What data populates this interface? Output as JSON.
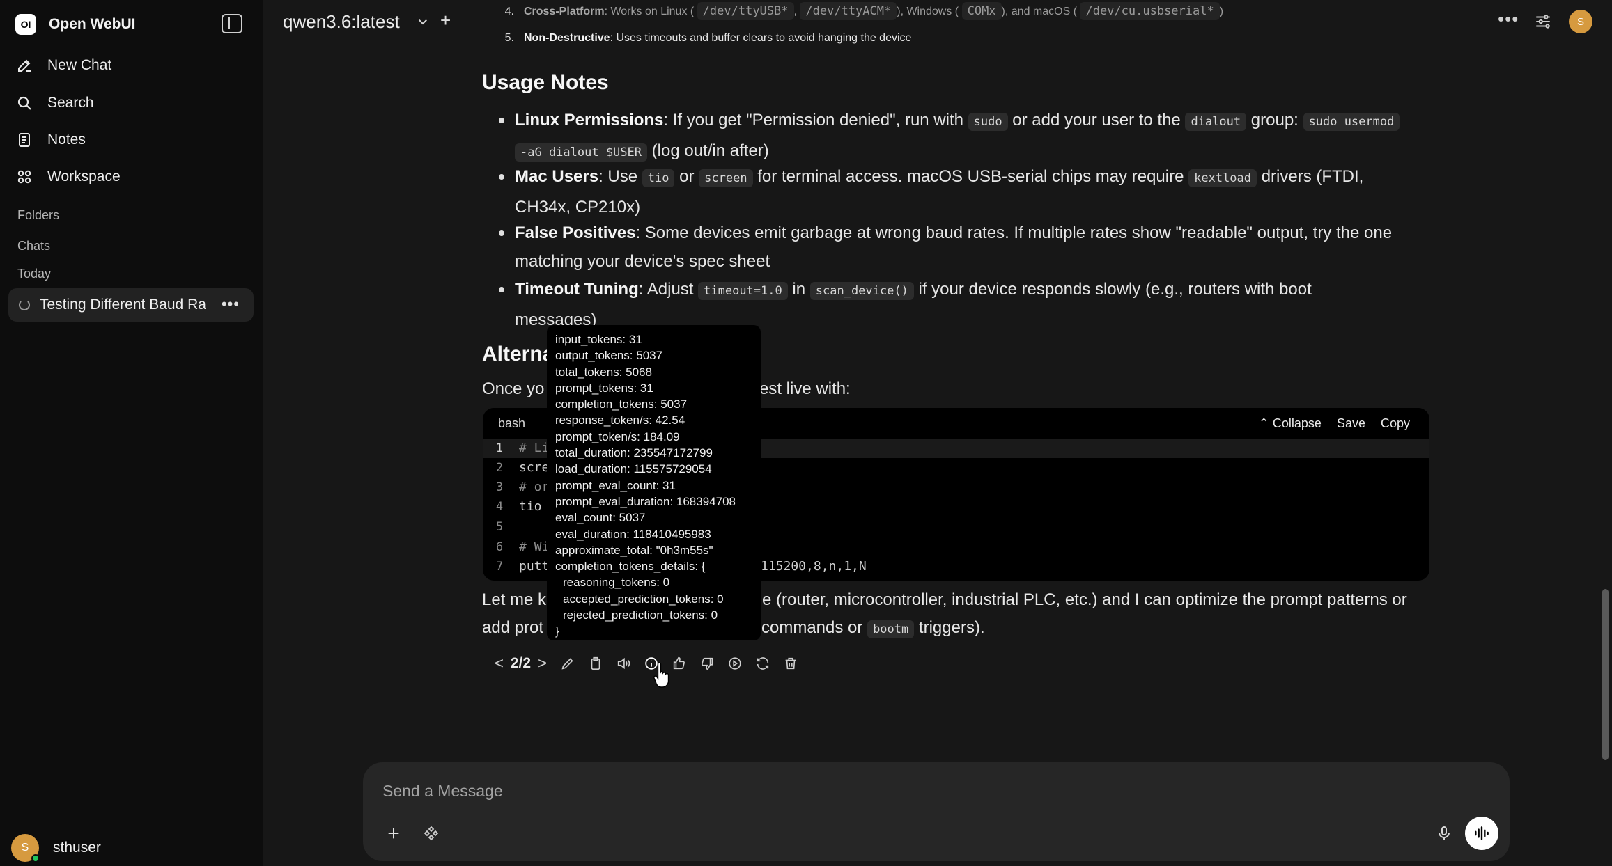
{
  "sidebar": {
    "brand_logo": "OI",
    "brand_name": "Open WebUI",
    "nav": [
      {
        "label": "New Chat",
        "icon": "edit-icon"
      },
      {
        "label": "Search",
        "icon": "search-icon"
      },
      {
        "label": "Notes",
        "icon": "notes-icon"
      },
      {
        "label": "Workspace",
        "icon": "workspace-icon"
      }
    ],
    "sections": {
      "folders": "Folders",
      "chats": "Chats",
      "today": "Today"
    },
    "active_chat": "Testing Different Baud Ra",
    "user": {
      "avatar": "S",
      "name": "sthuser"
    }
  },
  "header": {
    "model": "qwen3.6:latest",
    "avatar": "S"
  },
  "message": {
    "ol": [
      {
        "num": "4.",
        "title": "Cross-Platform",
        "p1": ": Works on Linux (",
        "c1": "/dev/ttyUSB*",
        "p2": ",",
        "c2": "/dev/ttyACM*",
        "p3": "), Windows (",
        "c3": "COMx",
        "p4": "), and macOS (",
        "c4": "/dev/cu.usbserial*",
        "p5": ")"
      },
      {
        "num": "5.",
        "title": "Non-Destructive",
        "text": ": Uses timeouts and buffer clears to avoid hanging the device"
      }
    ],
    "usage_heading": "Usage Notes",
    "usage": {
      "linux": {
        "title": "Linux Permissions",
        "t1": ": If you get \"Permission denied\", run with",
        "c1": "sudo",
        "t2": "or add your user to the",
        "c2": "dialout",
        "t3": "group:",
        "c3a": "sudo usermod",
        "c3b": "-aG dialout $USER",
        "t4": "(log out/in after)"
      },
      "mac": {
        "title": "Mac Users",
        "t1": ": Use",
        "c1": "tio",
        "t2": "or",
        "c2": "screen",
        "t3": "for terminal access. macOS USB-serial chips may require",
        "c3": "kextload",
        "t4": "drivers (FTDI,",
        "t5": "CH34x, CP210x)"
      },
      "false_pos": {
        "title": "False Positives",
        "t1": ": Some devices emit garbage at wrong baud rates. If multiple rates show \"readable\" output, try the one",
        "t2": "matching your device's spec sheet"
      },
      "timeout": {
        "title": "Timeout Tuning",
        "t1": ": Adjust",
        "c1": "timeout=1.0",
        "t2": "in",
        "c2": "scan_device()",
        "t3": "if your device responds slowly (e.g., routers with boot",
        "t4": "messages)"
      }
    },
    "alt_heading_visible": "Alterna",
    "once_left": "Once yo",
    "once_right": "est live with:",
    "codeblock": {
      "lang": "bash",
      "collapse": "Collapse",
      "save": "Save",
      "copy": "Copy",
      "lines": [
        {
          "n": "1",
          "code": "# Li"
        },
        {
          "n": "2",
          "code": "scre"
        },
        {
          "n": "3",
          "code": "# or"
        },
        {
          "n": "4",
          "code": "tio"
        },
        {
          "n": "5",
          "code": ""
        },
        {
          "n": "6",
          "code": "# Wi"
        },
        {
          "n": "7",
          "code": "putt"
        }
      ],
      "tail": "115200,8,n,1,N"
    },
    "closing": {
      "l1a": "Let me k",
      "l1b": "e (router, microcontroller, industrial PLC, etc.) and I can optimize the prompt patterns or",
      "l2a": "add prot",
      "l2b": "commands or",
      "l2c": "bootm",
      "l2d": "triggers)."
    },
    "pager": "2/2"
  },
  "tooltip": {
    "lines": [
      "input_tokens: 31",
      "output_tokens: 5037",
      "total_tokens: 5068",
      "prompt_tokens: 31",
      "completion_tokens: 5037",
      "response_token/s: 42.54",
      "prompt_token/s: 184.09",
      "total_duration: 235547172799",
      "load_duration: 115575729054",
      "prompt_eval_count: 31",
      "prompt_eval_duration: 168394708",
      "eval_count: 5037",
      "eval_duration: 118410495983",
      "approximate_total: \"0h3m55s\"",
      "completion_tokens_details: {",
      "reasoning_tokens: 0",
      "accepted_prediction_tokens: 0",
      "rejected_prediction_tokens: 0",
      "}"
    ]
  },
  "input": {
    "placeholder": "Send a Message"
  }
}
